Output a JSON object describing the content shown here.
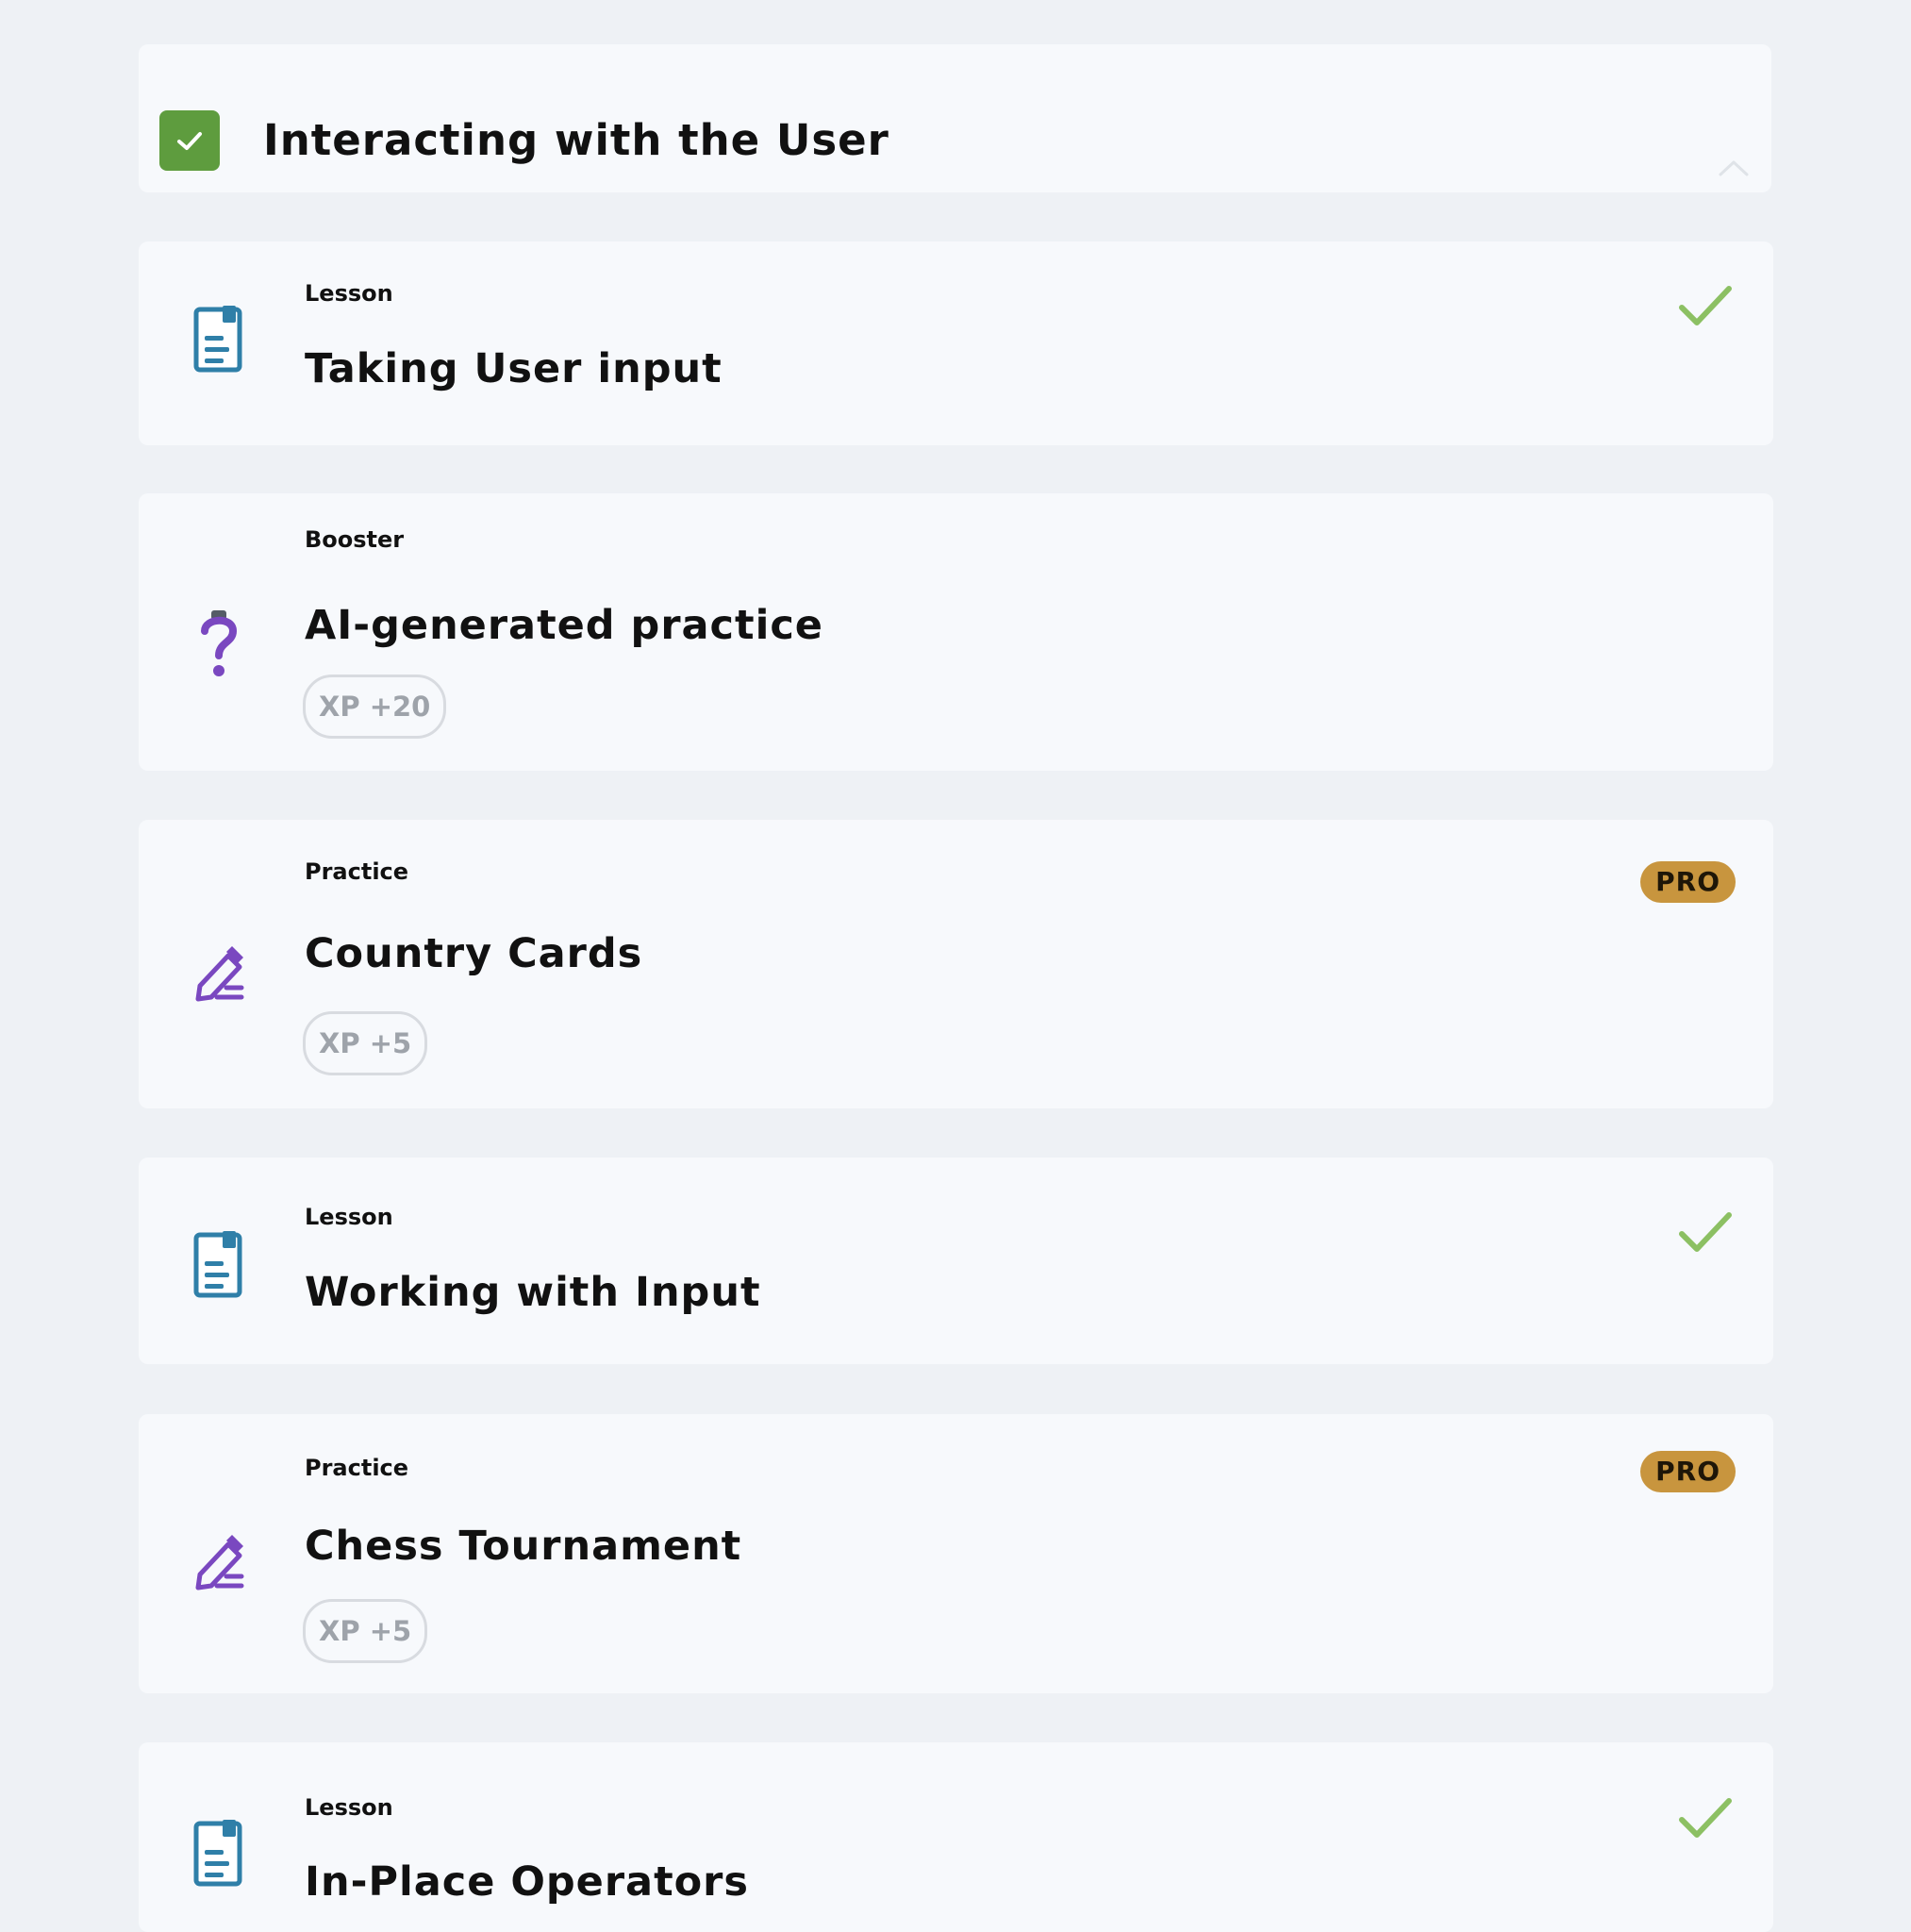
{
  "module": {
    "title": "Interacting with the User",
    "status_icon": "check-icon",
    "collapse_icon": "chevron-up-icon"
  },
  "items": [
    {
      "type": "Lesson",
      "title": "Taking User input",
      "icon": "document-icon",
      "completed": true
    },
    {
      "type": "Booster",
      "title": "AI-generated practice",
      "icon": "question-icon",
      "xp": "XP +20"
    },
    {
      "type": "Practice",
      "title": "Country Cards",
      "icon": "pencil-icon",
      "xp": "XP +5",
      "badge": "PRO"
    },
    {
      "type": "Lesson",
      "title": "Working with Input",
      "icon": "document-icon",
      "completed": true
    },
    {
      "type": "Practice",
      "title": "Chess Tournament",
      "icon": "pencil-icon",
      "xp": "XP +5",
      "badge": "PRO"
    },
    {
      "type": "Lesson",
      "title": "In-Place Operators",
      "icon": "document-icon",
      "completed": true
    }
  ],
  "colors": {
    "background": "#eef1f5",
    "card": "#f7f9fc",
    "module_check": "#5e9c3e",
    "completed_check": "#8cc063",
    "lesson_icon": "#2f7fa8",
    "practice_icon": "#7a48c0",
    "pro_badge": "#c8953e"
  }
}
